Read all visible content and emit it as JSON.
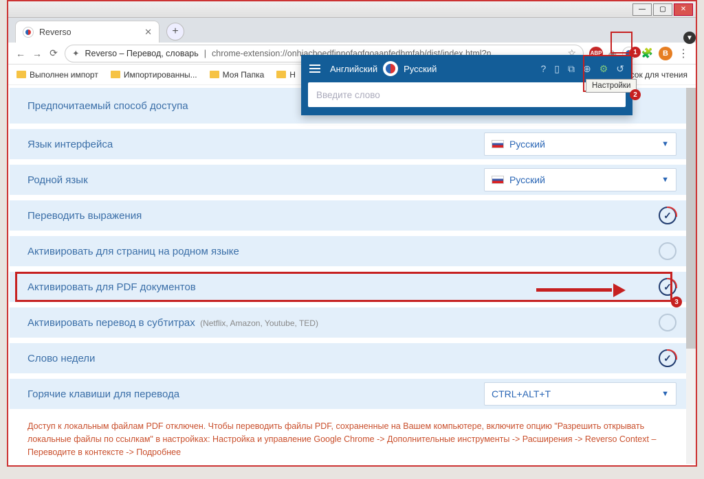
{
  "window": {
    "tab_title": "Reverso"
  },
  "addr": {
    "title": "Reverso – Перевод, словарь",
    "url": "chrome-extension://onhiacboedfinnofagfgoaanfedhmfab/dist/index.html?n..."
  },
  "toolbar_ext": {
    "avatar_letter": "B",
    "abp": "ABP"
  },
  "bookmarks": {
    "b1": "Выполнен импорт",
    "b2": "Импортированны...",
    "b3": "Моя Папка",
    "b4": "Н",
    "readlist": "исок для чтения"
  },
  "popup": {
    "lang_from": "Английский",
    "lang_to": "Русский",
    "placeholder": "Введите слово",
    "tooltip": "Настройки"
  },
  "settings": [
    {
      "label": "Предпочитаемый способ доступа",
      "type": "select_hidden"
    },
    {
      "label": "Язык интерфейса",
      "type": "select",
      "value": "Русский",
      "flag": true
    },
    {
      "label": "Родной язык",
      "type": "select",
      "value": "Русский",
      "flag": true
    },
    {
      "label": "Переводить выражения",
      "type": "toggle",
      "on": true
    },
    {
      "label": "Активировать для страниц на родном языке",
      "type": "toggle",
      "on": false
    },
    {
      "label": "Активировать для PDF документов",
      "type": "toggle",
      "on": true
    },
    {
      "label": "Активировать перевод в субтитрах",
      "sub": "(Netflix, Amazon, Youtube, TED)",
      "type": "toggle",
      "on": false
    },
    {
      "label": "Слово недели",
      "type": "toggle",
      "on": true
    },
    {
      "label": "Горячие клавиши для перевода",
      "type": "select",
      "value": "CTRL+ALT+T",
      "flag": false
    }
  ],
  "warning": "Доступ к локальным файлам PDF отключен. Чтобы переводить файлы PDF, сохраненные на Вашем компьютере, включите опцию \"Разрешить открывать локальные файлы по ссылкам\" в настройках: Настройка и управление Google Chrome -> Дополнительные инструменты -> Расширения -> Reverso Context – Переводите в контексте -> Подробнее",
  "annot": {
    "b1": "1",
    "b2": "2",
    "b3": "3"
  }
}
